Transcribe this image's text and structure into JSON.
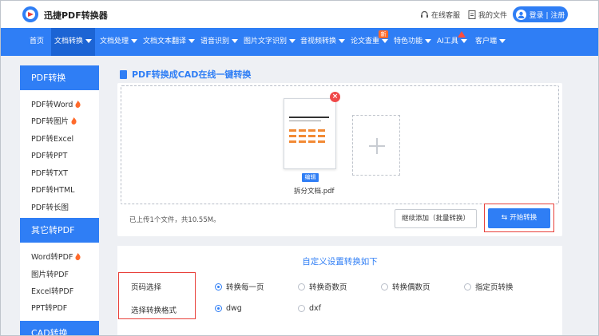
{
  "header": {
    "brand": "迅捷PDF转换器",
    "links": {
      "service": "在线客服",
      "my_files": "我的文件"
    },
    "login": "登录 | 注册"
  },
  "nav": {
    "items": [
      {
        "label": "首页"
      },
      {
        "label": "文档转换"
      },
      {
        "label": "文档处理"
      },
      {
        "label": "文档文本翻译"
      },
      {
        "label": "语音识别"
      },
      {
        "label": "图片文字识别"
      },
      {
        "label": "音视频转换"
      },
      {
        "label": "论文查重"
      },
      {
        "label": "特色功能"
      },
      {
        "label": "AI工具"
      },
      {
        "label": "客户端"
      }
    ],
    "new_badge": "新"
  },
  "sidebar": {
    "groups": [
      {
        "title": "PDF转换",
        "items": [
          "PDF转Word",
          "PDF转图片",
          "PDF转Excel",
          "PDF转PPT",
          "PDF转TXT",
          "PDF转HTML",
          "PDF转长图"
        ]
      },
      {
        "title": "其它转PDF",
        "items": [
          "Word转PDF",
          "图片转PDF",
          "Excel转PDF",
          "PPT转PDF"
        ]
      },
      {
        "title": "CAD转换",
        "items": []
      }
    ]
  },
  "main": {
    "title": "PDF转换成CAD在线一键转换",
    "file": {
      "edit_label": "编辑",
      "name": "拆分文档.pdf"
    },
    "status": "已上传1个文件，共10.55M。",
    "continue_label": "继续添加（批量转换）",
    "start_label": "开始转换"
  },
  "settings": {
    "title": "自定义设置转换如下",
    "rows": [
      {
        "label": "页码选择",
        "options": [
          "转换每一页",
          "转换奇数页",
          "转换偶数页",
          "指定页转换"
        ],
        "selected": 0
      },
      {
        "label": "选择转换格式",
        "options": [
          "dwg",
          "dxf"
        ],
        "selected": 0
      }
    ]
  },
  "colors": {
    "primary": "#2f7ef5",
    "highlight": "#e8403a",
    "hot": "#ff6a2b"
  }
}
